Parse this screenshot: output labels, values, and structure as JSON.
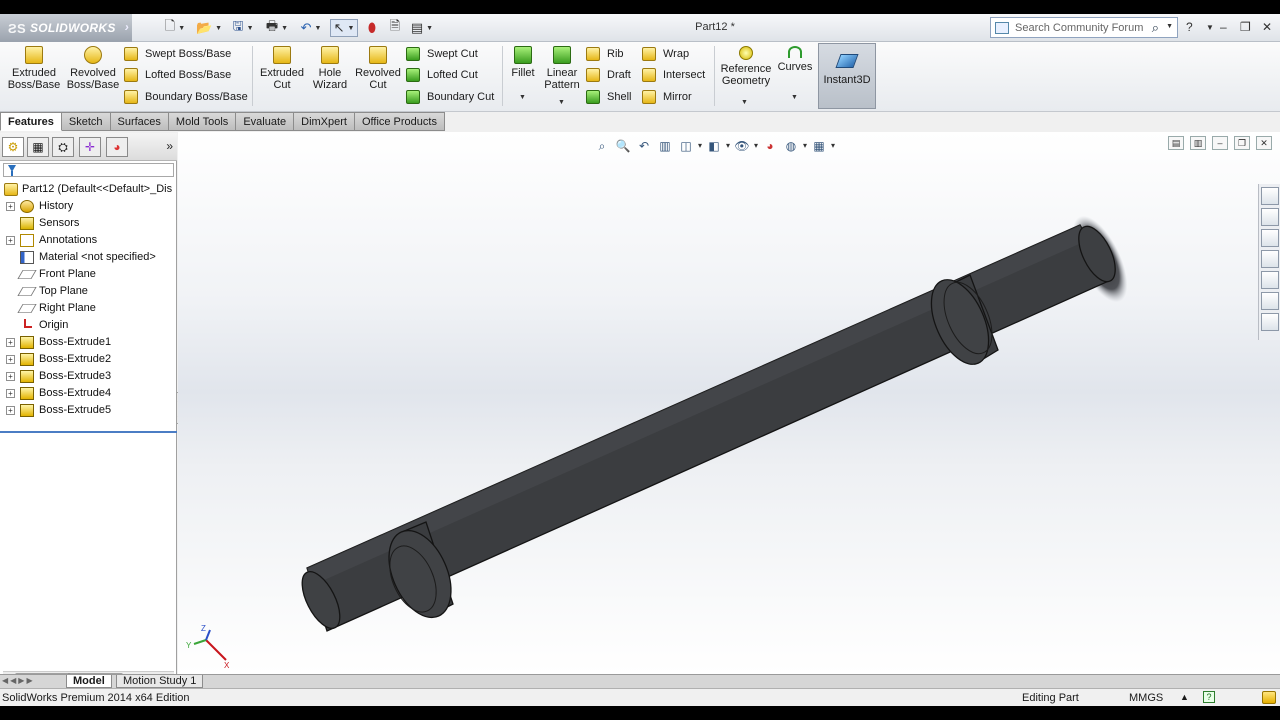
{
  "app": {
    "brand": "SOLIDWORKS",
    "document_title": "Part12 *",
    "search_placeholder": "Search Community Forum"
  },
  "ribbon": {
    "extruded_boss": "Extruded\nBoss/Base",
    "revolved_boss": "Revolved\nBoss/Base",
    "swept_boss": "Swept Boss/Base",
    "lofted_boss": "Lofted Boss/Base",
    "boundary_boss": "Boundary Boss/Base",
    "extruded_cut": "Extruded\nCut",
    "hole_wizard": "Hole\nWizard",
    "revolved_cut": "Revolved\nCut",
    "swept_cut": "Swept Cut",
    "lofted_cut": "Lofted Cut",
    "boundary_cut": "Boundary Cut",
    "fillet": "Fillet",
    "linear_pattern": "Linear\nPattern",
    "rib": "Rib",
    "draft": "Draft",
    "shell": "Shell",
    "wrap": "Wrap",
    "intersect": "Intersect",
    "mirror": "Mirror",
    "reference_geometry": "Reference\nGeometry",
    "curves": "Curves",
    "instant3d": "Instant3D"
  },
  "tabs": [
    "Features",
    "Sketch",
    "Surfaces",
    "Mold Tools",
    "Evaluate",
    "DimXpert",
    "Office Products"
  ],
  "feature_tree": {
    "root": "Part12  (Default<<Default>_Dis",
    "items": [
      {
        "label": "History",
        "icon": "history-icon",
        "expandable": true
      },
      {
        "label": "Sensors",
        "icon": "sensor-icon",
        "expandable": false
      },
      {
        "label": "Annotations",
        "icon": "annotation-icon",
        "expandable": true
      },
      {
        "label": "Material <not specified>",
        "icon": "material-icon",
        "expandable": false
      },
      {
        "label": "Front Plane",
        "icon": "plane-icon",
        "expandable": false
      },
      {
        "label": "Top Plane",
        "icon": "plane-icon",
        "expandable": false
      },
      {
        "label": "Right Plane",
        "icon": "plane-icon",
        "expandable": false
      },
      {
        "label": "Origin",
        "icon": "origin-icon",
        "expandable": false
      },
      {
        "label": "Boss-Extrude1",
        "icon": "extrude-feature-icon",
        "expandable": true
      },
      {
        "label": "Boss-Extrude2",
        "icon": "extrude-feature-icon",
        "expandable": true
      },
      {
        "label": "Boss-Extrude3",
        "icon": "extrude-feature-icon",
        "expandable": true
      },
      {
        "label": "Boss-Extrude4",
        "icon": "extrude-feature-icon",
        "expandable": true
      },
      {
        "label": "Boss-Extrude5",
        "icon": "extrude-feature-icon",
        "expandable": true
      }
    ]
  },
  "bottom_tabs": [
    "Model",
    "Motion Study 1"
  ],
  "status": {
    "edition": "SolidWorks Premium 2014 x64 Edition",
    "mode": "Editing Part",
    "units": "MMGS"
  },
  "triad": {
    "x": "X",
    "y": "Y",
    "z": "Z"
  },
  "colors": {
    "model": "#3a3c3f",
    "accent": "#4b7dc4",
    "viewport_mid": "#e1e5ec"
  }
}
